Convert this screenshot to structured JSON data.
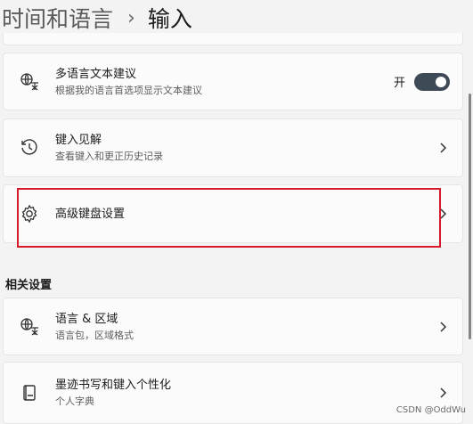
{
  "breadcrumb": {
    "parent": "时间和语言",
    "separator": "›",
    "current": "输入"
  },
  "settings": [
    {
      "title": "多语言文本建议",
      "subtitle": "根据我的语言首选项显示文本建议",
      "icon": "language-text-icon",
      "control": "toggle",
      "toggle_label": "开",
      "toggle_on": true
    },
    {
      "title": "键入见解",
      "subtitle": "查看键入和更正历史记录",
      "icon": "history-icon",
      "control": "chevron"
    },
    {
      "title": "高级键盘设置",
      "subtitle": "",
      "icon": "gear-icon",
      "control": "chevron",
      "highlighted": true
    }
  ],
  "related": {
    "section_title": "相关设置",
    "items": [
      {
        "title": "语言 & 区域",
        "subtitle": "语言包，区域格式",
        "icon": "language-region-icon",
        "control": "chevron"
      },
      {
        "title": "墨迹书写和键入个性化",
        "subtitle": "个人字典",
        "icon": "notebook-icon",
        "control": "chevron"
      }
    ]
  },
  "watermark": "CSDN @OddWu",
  "colors": {
    "toggle_on": "#3e4a56",
    "highlight_border": "#d91a2a",
    "background": "#f3f3f3"
  }
}
